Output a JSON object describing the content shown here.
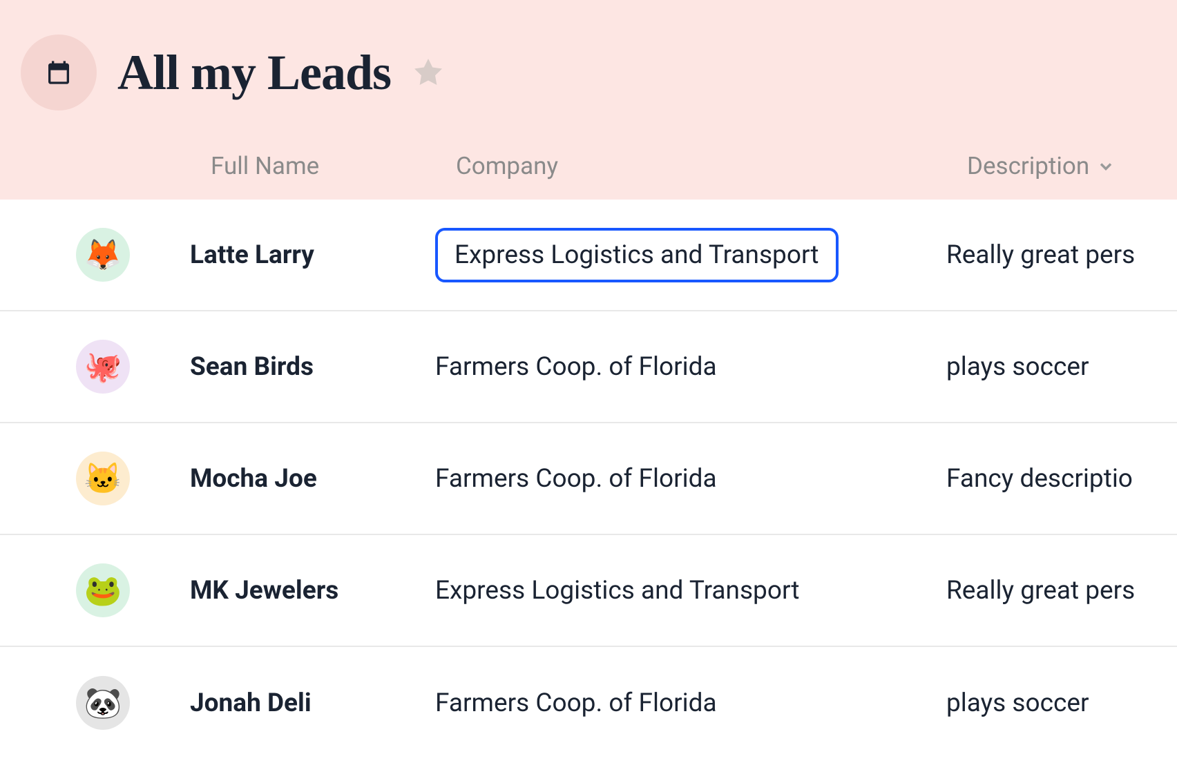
{
  "header": {
    "title": "All my Leads"
  },
  "columns": {
    "full_name": "Full Name",
    "company": "Company",
    "description": "Description"
  },
  "rows": [
    {
      "avatar_emoji": "🦊",
      "avatar_bg": "#d9f2e3",
      "name": "Latte Larry",
      "company": "Express Logistics and Transport",
      "company_selected": true,
      "description": "Really great pers"
    },
    {
      "avatar_emoji": "🐙",
      "avatar_bg": "#efe2f5",
      "name": "Sean Birds",
      "company": "Farmers Coop. of Florida",
      "company_selected": false,
      "description": "plays soccer"
    },
    {
      "avatar_emoji": "🐱",
      "avatar_bg": "#fdeccf",
      "name": "Mocha Joe",
      "company": "Farmers Coop. of Florida",
      "company_selected": false,
      "description": "Fancy descriptio"
    },
    {
      "avatar_emoji": "🐸",
      "avatar_bg": "#d9f2e3",
      "name": "MK Jewelers",
      "company": "Express Logistics and Transport",
      "company_selected": false,
      "description": "Really great pers"
    },
    {
      "avatar_emoji": "🐼",
      "avatar_bg": "#e5e5e5",
      "name": "Jonah Deli",
      "company": "Farmers Coop. of Florida",
      "company_selected": false,
      "description": "plays soccer"
    }
  ]
}
